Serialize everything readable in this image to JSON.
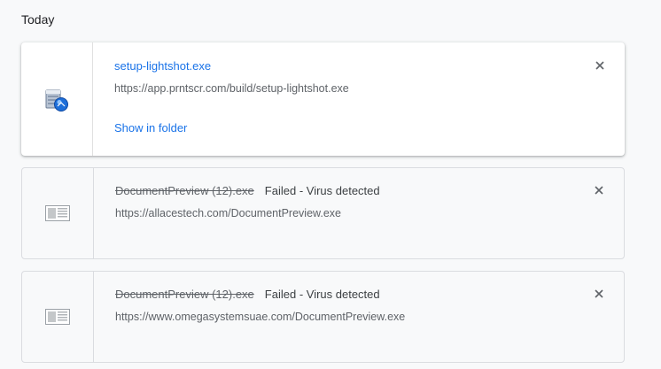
{
  "section": {
    "date_label": "Today"
  },
  "downloads": [
    {
      "file_name": "setup-lightshot.exe",
      "url": "https://app.prntscr.com/build/setup-lightshot.exe",
      "action_label": "Show in folder",
      "icon": "installer-icon"
    },
    {
      "file_name": "DocumentPreview (12).exe",
      "status": "Failed - Virus detected",
      "url": "https://allacestech.com/DocumentPreview.exe",
      "icon": "generic-file-icon"
    },
    {
      "file_name": "DocumentPreview (12).exe",
      "status": "Failed - Virus detected",
      "url": "https://www.omegasystemsuae.com/DocumentPreview.exe",
      "icon": "generic-file-icon"
    }
  ],
  "colors": {
    "link": "#1a73e8",
    "muted_text": "#5f6368",
    "background": "#f8f9fa",
    "card_border": "#dadce0"
  }
}
